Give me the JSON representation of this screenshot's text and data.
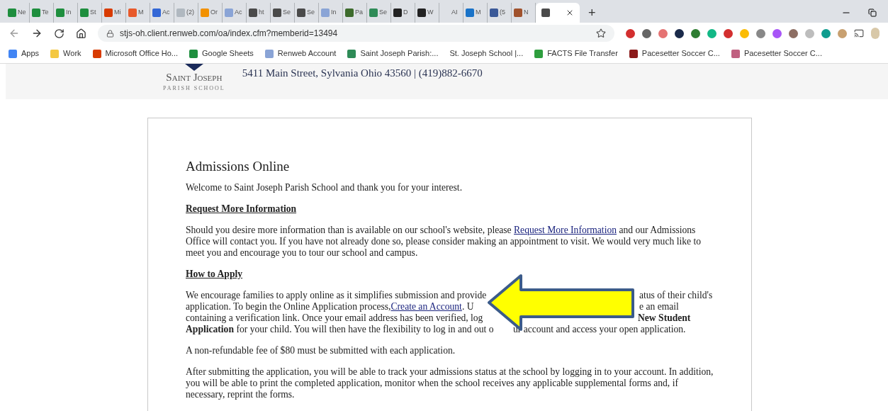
{
  "browser": {
    "tabs": [
      {
        "label": "Ne",
        "color": "#1e8e3e",
        "selected": false
      },
      {
        "label": "Te",
        "color": "#1e8e3e",
        "selected": false
      },
      {
        "label": "In",
        "color": "#1e8e3e",
        "selected": false
      },
      {
        "label": "St",
        "color": "#1e8e3e",
        "selected": false
      },
      {
        "label": "Mi",
        "color": "#d83b01",
        "selected": false
      },
      {
        "label": "M",
        "color": "#e8592a",
        "selected": false
      },
      {
        "label": "Ac",
        "color": "#3367d6",
        "selected": false
      },
      {
        "label": "(2)",
        "color": "#b0b8c0",
        "selected": false
      },
      {
        "label": "Or",
        "color": "#f29100",
        "selected": false
      },
      {
        "label": "Ac",
        "color": "#8aa4d6",
        "selected": false
      },
      {
        "label": "ht",
        "color": "#4a4a4a",
        "selected": false
      },
      {
        "label": "Se",
        "color": "#4a4a4a",
        "selected": false
      },
      {
        "label": "Se",
        "color": "#4a4a4a",
        "selected": false
      },
      {
        "label": "In",
        "color": "#8aa4d6",
        "selected": false
      },
      {
        "label": "Pa",
        "color": "#3d6b2c",
        "selected": false
      },
      {
        "label": "Se",
        "color": "#2e8b57",
        "selected": false
      },
      {
        "label": "D",
        "color": "#222222",
        "selected": false
      },
      {
        "label": "W",
        "color": "#222222",
        "selected": false
      },
      {
        "label": "AI",
        "selected": false
      },
      {
        "label": "M",
        "color": "#1a73c8",
        "selected": false
      },
      {
        "label": "(5",
        "color": "#3b5998",
        "selected": false
      },
      {
        "label": "N",
        "color": "#a0522d",
        "selected": false
      },
      {
        "color": "#4a4a4a",
        "selected": true
      }
    ],
    "new_tab": "+",
    "url": "stjs-oh.client.renweb.com/oa/index.cfm?memberid=13494",
    "bookmarks": [
      {
        "label": "Apps",
        "color": "#4285f4"
      },
      {
        "label": "Work",
        "color": "#f4c842"
      },
      {
        "label": "Microsoft Office Ho...",
        "color": "#d83b01"
      },
      {
        "label": "Google Sheets",
        "color": "#1e8e3e"
      },
      {
        "label": "Renweb Account",
        "color": "#8aa4d6"
      },
      {
        "label": "Saint Joseph Parish:...",
        "color": "#2e8b57"
      },
      {
        "label": "St. Joseph School |..."
      },
      {
        "label": "FACTS File Transfer",
        "color": "#2e9e3e"
      },
      {
        "label": "Pacesetter Soccer C...",
        "color": "#8b1a1a"
      },
      {
        "label": "Pacesetter Soccer C...",
        "color": "#c06080"
      }
    ]
  },
  "header": {
    "logo_name": "Saint Joseph",
    "logo_sub": "PARISH SCHOOL",
    "address": "5411 Main Street, Sylvania Ohio 43560 | (419)882-6670"
  },
  "content": {
    "title": "Admissions Online",
    "welcome": "Welcome to Saint Joseph Parish School and thank you for your interest.",
    "heading_1": "Request More Information",
    "para_1": {
      "before": "Should you desire more information than is available on our school's website, please ",
      "link": "Request More Information",
      "after": " and our Admissions Office will contact you. If you have not already done so, please consider making an appointment to visit. We would very much like to meet you and encourage you to tour our school and campus."
    },
    "heading_2": "How to Apply",
    "apply_lines": [
      {
        "left": [
          {
            "kind": "text",
            "text": "We encourage families to apply online as it simplifies submission and provide"
          }
        ],
        "right": [
          {
            "kind": "text",
            "text": "atus of their child's"
          }
        ]
      },
      {
        "left": [
          {
            "kind": "text",
            "text": "application. To begin the Online Application process, "
          },
          {
            "kind": "link",
            "text": "Create an Account"
          },
          {
            "kind": "text",
            "text": ". U"
          }
        ],
        "right": [
          {
            "kind": "text",
            "text": "e an email"
          }
        ]
      },
      {
        "left": [
          {
            "kind": "text",
            "text": "containing a verification link. Once your email address has been verified, log"
          }
        ],
        "right": [
          {
            "kind": "bold",
            "text": "New Student"
          }
        ]
      },
      {
        "left": [
          {
            "kind": "text",
            "text": "**Application** for your child. You will then have the flexibility to log in and out o"
          }
        ],
        "right": [
          {
            "kind": "text",
            "text": "ur account and access your open application."
          }
        ]
      }
    ],
    "fee": "A non-refundable fee of $80 must be submitted with each application.",
    "after": "After submitting the application, you will be able to track your admissions status at the school by logging in to your account. In addition, you will be able to print the completed application, monitor when the school receives any applicable supplemental forms and, if necessary, reprint the forms."
  }
}
